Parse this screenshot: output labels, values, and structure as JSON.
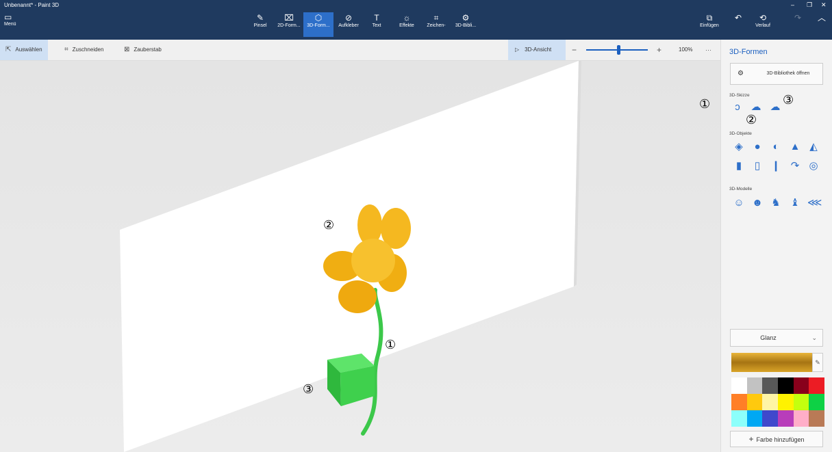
{
  "window": {
    "title": "Unbenannt* - Paint 3D",
    "controls": [
      "–",
      "❐",
      "✕"
    ]
  },
  "ribbon": {
    "menu_label": "Menü",
    "tools": [
      {
        "label": "Pinsel",
        "icon": "brush-icon"
      },
      {
        "label": "2D-Form...",
        "icon": "2d-shapes-icon"
      },
      {
        "label": "3D-Form...",
        "icon": "3d-shapes-icon",
        "active": true
      },
      {
        "label": "Aufkleber",
        "icon": "sticker-icon"
      },
      {
        "label": "Text",
        "icon": "text-icon"
      },
      {
        "label": "Effekte",
        "icon": "effects-icon"
      },
      {
        "label": "Zeichen-",
        "icon": "canvas-icon"
      },
      {
        "label": "3D-Bibli...",
        "icon": "3d-library-icon"
      }
    ],
    "paste_label": "Einfügen",
    "history_label": "Verlauf"
  },
  "toolbar": {
    "select_label": "Auswählen",
    "crop_label": "Zuschneiden",
    "magic_select_label": "Zauberstab",
    "view3d_label": "3D-Ansicht",
    "zoom_value": "100%",
    "zoom_level_fraction": 0.5,
    "more_label": "···"
  },
  "panel": {
    "title": "3D-Formen",
    "library_button": "3D-Bibliothek öffnen",
    "doodle_section": "3D-Skizze",
    "objects_section": "3D-Objekte",
    "models_section": "3D-Modelle",
    "material_value": "Glanz",
    "add_color_label": "Farbe hinzufügen",
    "selected_color": "#c9951f",
    "palette": [
      "#ffffff",
      "#c2c2c2",
      "#585858",
      "#000000",
      "#88001b",
      "#ec1c24",
      "#ff7f27",
      "#ffc90e",
      "#fff5a5",
      "#fff200",
      "#c4ff0e",
      "#0ed145",
      "#8cfffb",
      "#00a8f3",
      "#3f48cc",
      "#b83dba",
      "#ffaec8",
      "#b97a56"
    ]
  },
  "callouts": {
    "panel": [
      "①",
      "②",
      "③"
    ],
    "canvas": [
      "②",
      "①",
      "③"
    ]
  },
  "colors": {
    "accent": "#1b5fbf",
    "title_bar": "#1f3a5f",
    "flower": "#f5b820",
    "stem": "#3cc84a"
  }
}
